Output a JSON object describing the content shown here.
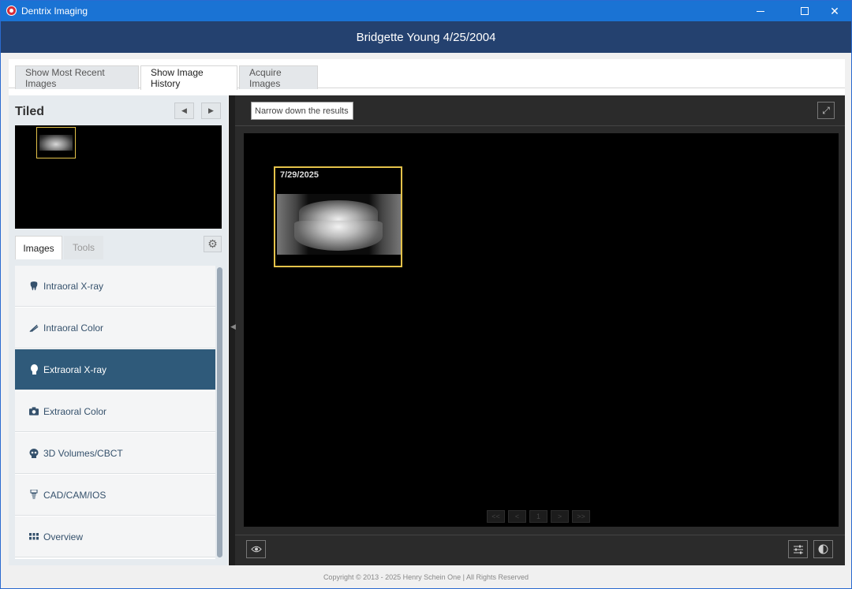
{
  "window": {
    "title": "Dentrix Imaging"
  },
  "patient": {
    "header": "Bridgette Young 4/25/2004"
  },
  "top_tabs": [
    {
      "label": "Show Most Recent Images"
    },
    {
      "label": "Show Image History"
    },
    {
      "label": "Acquire Images"
    }
  ],
  "left_panel": {
    "title": "Tiled",
    "sub_tabs": [
      {
        "label": "Images"
      },
      {
        "label": "Tools"
      }
    ],
    "categories": [
      {
        "label": "Intraoral X-ray",
        "icon": "tooth-icon"
      },
      {
        "label": "Intraoral Color",
        "icon": "intraoral-camera-icon"
      },
      {
        "label": "Extraoral X-ray",
        "icon": "head-icon",
        "active": true
      },
      {
        "label": "Extraoral Color",
        "icon": "camera-icon"
      },
      {
        "label": "3D Volumes/CBCT",
        "icon": "skull-icon"
      },
      {
        "label": "CAD/CAM/IOS",
        "icon": "implant-icon"
      },
      {
        "label": "Overview",
        "icon": "grid-icon"
      }
    ]
  },
  "viewer": {
    "filter_placeholder": "Narrow down the results",
    "image_card": {
      "date": "7/29/2025"
    },
    "pager": [
      "<<",
      "<",
      "1",
      ">",
      ">>"
    ]
  },
  "footer": {
    "copyright": "Copyright © 2013 - 2025 Henry Schein One | All Rights Reserved"
  },
  "colors": {
    "titlebar": "#1a73d4",
    "header": "#24416f",
    "active_item": "#2f5a7a",
    "highlight": "#e4c24a"
  }
}
